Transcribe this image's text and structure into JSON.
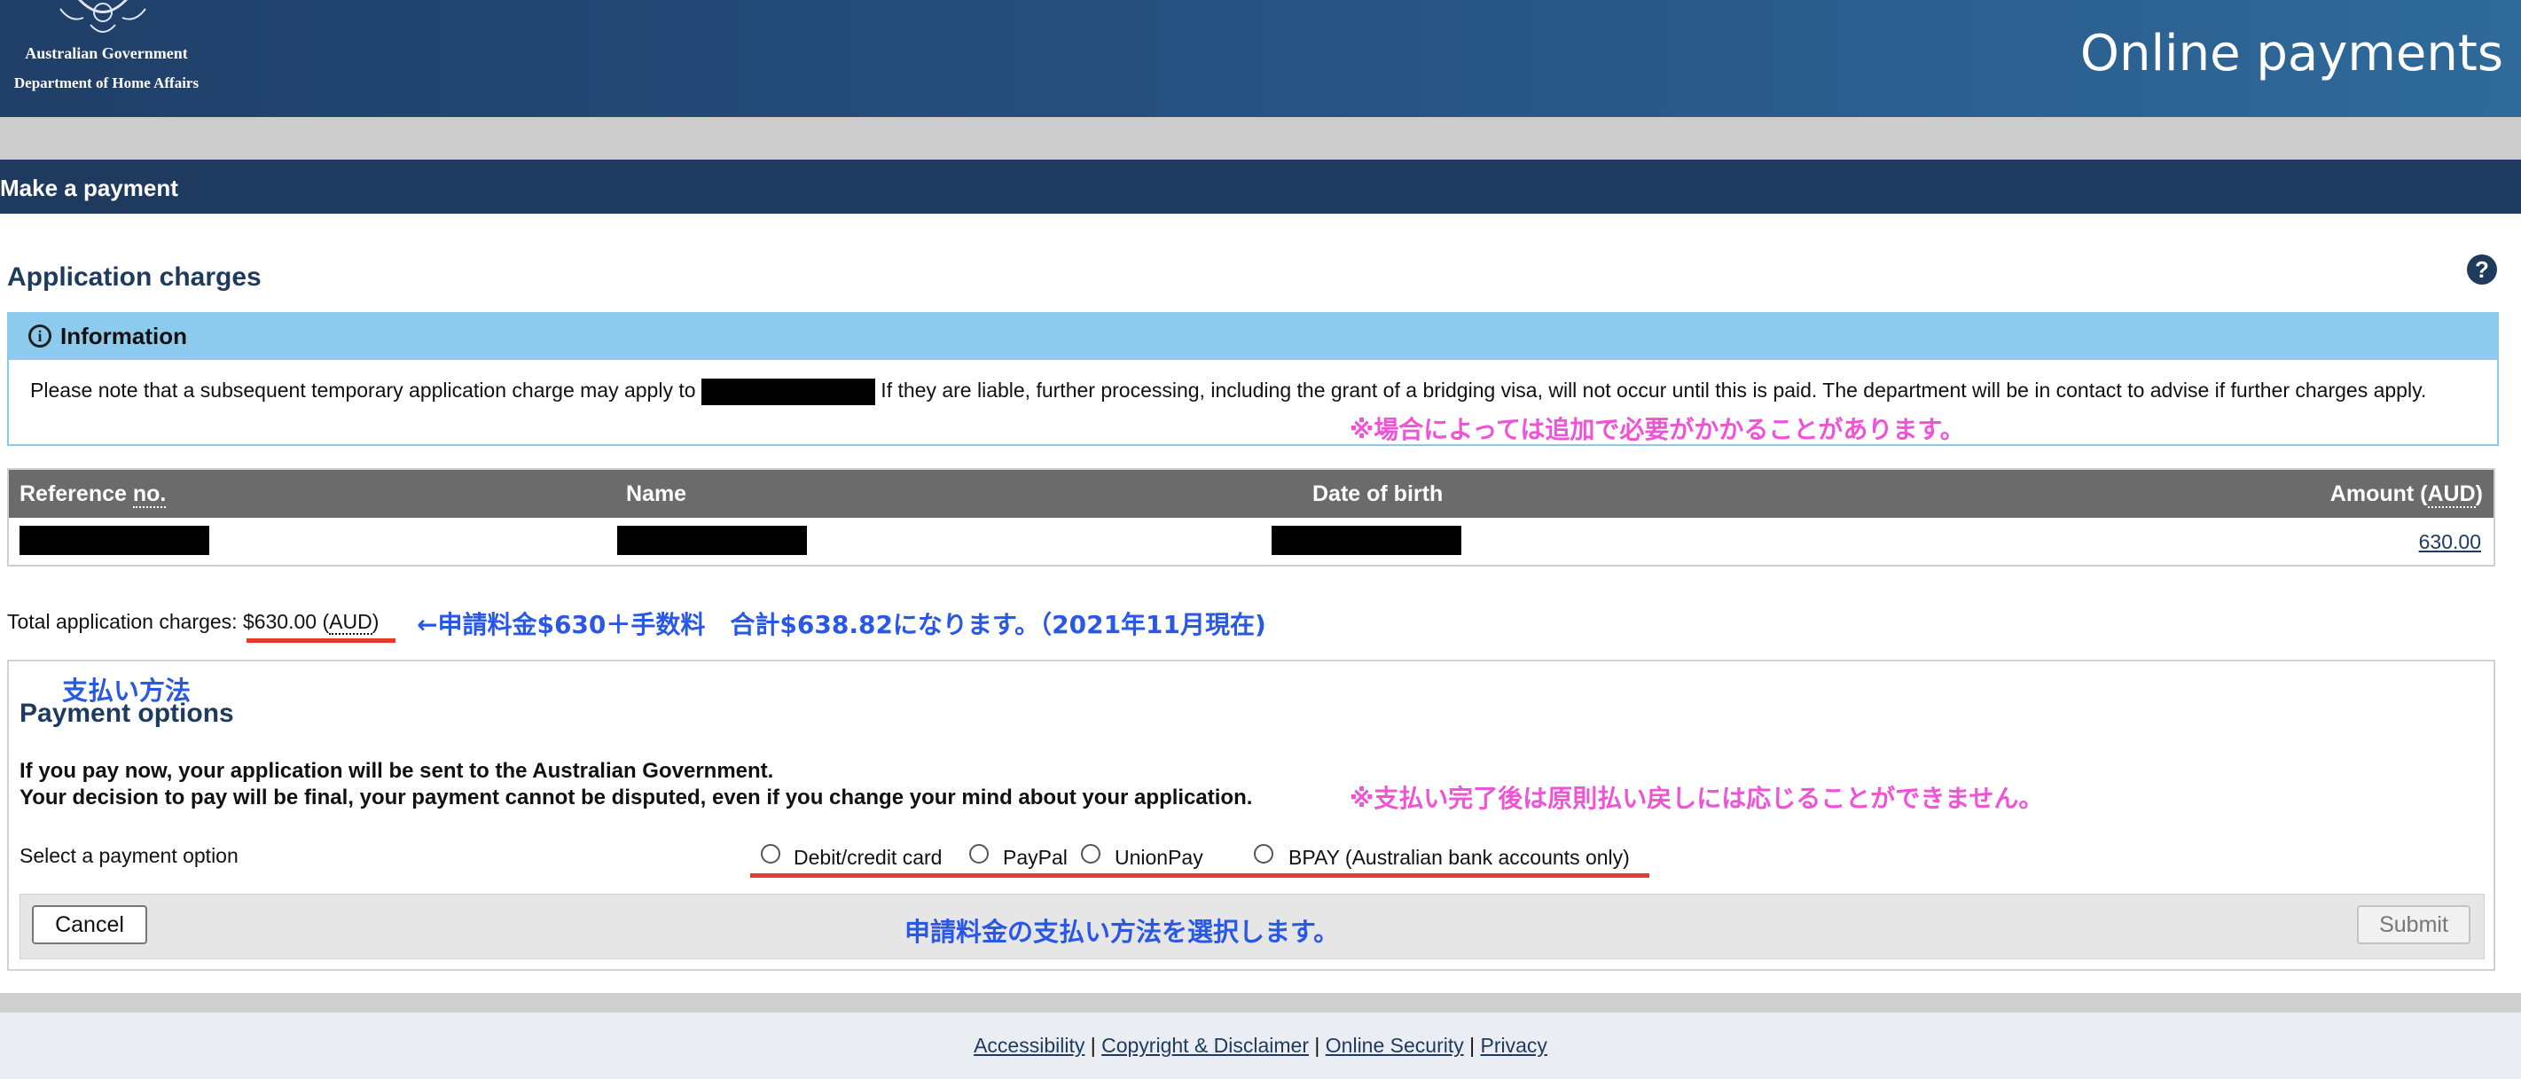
{
  "header": {
    "gov_name": "Australian Government",
    "dept_name": "Department of Home Affairs",
    "site_title": "Online payments"
  },
  "page_bar": {
    "title": "Make a payment"
  },
  "application_charges": {
    "title": "Application charges",
    "help_icon": "question-mark-icon"
  },
  "info": {
    "title": "Information",
    "text_before": "Please note that a subsequent temporary application charge may apply to",
    "text_after": " If they are liable, further processing, including the grant of a bridging visa, will not occur until this is paid. The department will be in contact to advise if further charges apply."
  },
  "table": {
    "headers": {
      "reference_prefix": "Reference ",
      "reference_abbr": "no.",
      "name": "Name",
      "dob": "Date of birth",
      "amount_prefix": "Amount (",
      "amount_abbr": "AUD",
      "amount_suffix": ")"
    },
    "rows": [
      {
        "amount": "630.00"
      }
    ]
  },
  "total": {
    "label": "Total application charges: ",
    "value": "$630.00 (",
    "currency": "AUD",
    "close": ")"
  },
  "payment_options": {
    "title": "Payment options",
    "warning_1": "If you pay now, your application will be sent to the Australian Government.",
    "warning_2": "Your decision to pay will be final, your payment cannot be disputed, even if you change your mind about your application.",
    "select_label": "Select a payment option",
    "options": [
      "Debit/credit card",
      "PayPal",
      "UnionPay",
      "BPAY (Australian bank accounts only)"
    ],
    "cancel_label": "Cancel",
    "submit_label": "Submit"
  },
  "annotations": {
    "extra_charge_note": "※場合によっては追加で必要がかかることがあります。",
    "total_note": "←申請料金$630＋手数料　合計$638.82になります。（2021年11月現在)",
    "payment_method_heading": "支払い方法",
    "no_refund_note": "※支払い完了後は原則払い戻しには応じることができません。",
    "select_method_note": "申請料金の支払い方法を選択します。"
  },
  "footer": {
    "links": [
      "Accessibility",
      "Copyright & Disclaimer",
      "Online Security",
      "Privacy"
    ],
    "separator": "|"
  },
  "colors": {
    "header_dark": "#1f3f68",
    "page_bar": "#1e3a5f",
    "info_head": "#8ccbed",
    "annotation_pink": "#ef53d6",
    "annotation_blue": "#2a58e6",
    "underline_red": "#e53b2c"
  }
}
